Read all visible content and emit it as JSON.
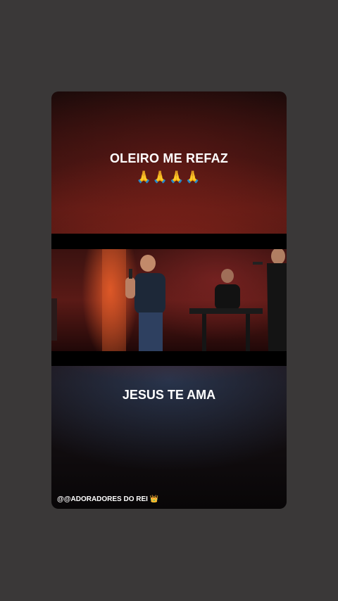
{
  "story": {
    "top_title": "OLEIRO ME REFAZ",
    "emojis": "🙏🙏🙏🙏",
    "bottom_title": "JESUS TE AMA",
    "credit": "@@ADORADORES DO REI 👑"
  },
  "video": {
    "subject": "worship band performing on stage",
    "icons": [
      "singer",
      "keyboard-player",
      "female-singer"
    ]
  }
}
